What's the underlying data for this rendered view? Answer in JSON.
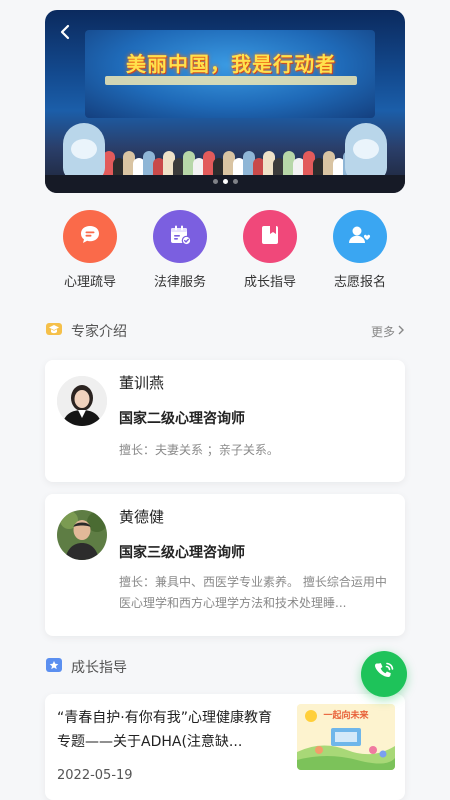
{
  "banner": {
    "headline": "美丽中国，我是行动者",
    "active_dot": 1,
    "dot_count": 3
  },
  "quick_menu": [
    {
      "label": "心理疏导",
      "icon": "chat-bubble-icon",
      "color": "#fa6a4a"
    },
    {
      "label": "法律服务",
      "icon": "calendar-check-icon",
      "color": "#7b5fe0"
    },
    {
      "label": "成长指导",
      "icon": "bookmark-book-icon",
      "color": "#f0487a"
    },
    {
      "label": "志愿报名",
      "icon": "user-heart-icon",
      "color": "#3aa6f2"
    }
  ],
  "experts_section": {
    "title": "专家介绍",
    "more_label": "更多",
    "icon_color": "#f5c04a"
  },
  "experts": [
    {
      "name": "董训燕",
      "role": "国家二级心理咨询师",
      "desc": "擅长：夫妻关系 ；亲子关系。"
    },
    {
      "name": "黄德健",
      "role": "国家三级心理咨询师",
      "desc": "擅长：兼具中、西医学专业素养。 擅长综合运用中医心理学和西方心理学方法和技术处理睡..."
    }
  ],
  "growth_section": {
    "title": "成长指导",
    "icon_color": "#5b8ff0"
  },
  "articles": [
    {
      "title": "“青春自护·有你有我”心理健康教育专题——关于ADHA(注意缺...",
      "date": "2022-05-19",
      "thumb_caption": "一起向未来"
    }
  ],
  "fab": {
    "icon": "phone-icon",
    "color": "#1ec35a"
  }
}
